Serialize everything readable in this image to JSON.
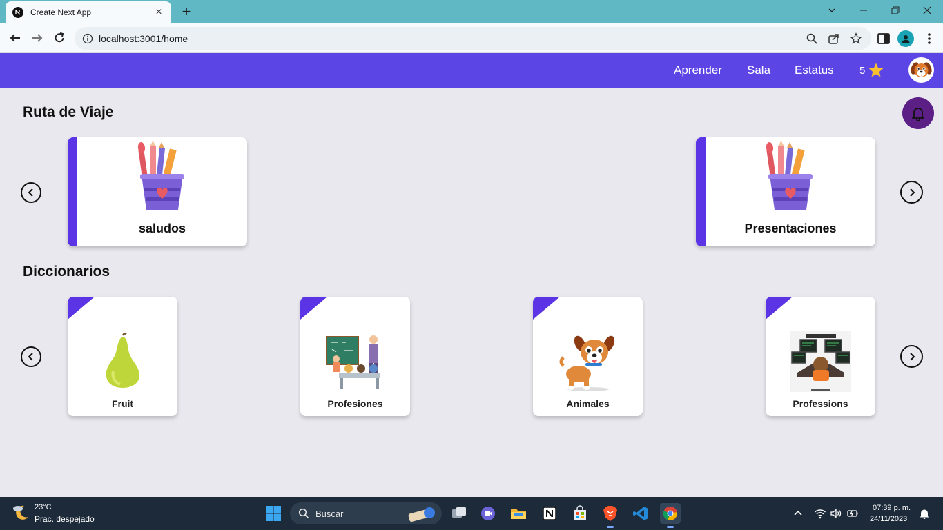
{
  "browser": {
    "tab_title": "Create Next App",
    "url": "localhost:3001/home",
    "icons": [
      "back-icon",
      "forward-icon",
      "reload-icon",
      "info-icon",
      "zoom-icon",
      "share-icon",
      "bookmark-star-icon",
      "side-panel-icon",
      "profile-icon",
      "menu-icon"
    ]
  },
  "header": {
    "nav": [
      "Aprender",
      "Sala",
      "Estatus"
    ],
    "stars": "5",
    "accent": "#5b46e5"
  },
  "route": {
    "title": "Ruta de Viaje",
    "cards": [
      {
        "label": "saludos"
      },
      {
        "label": "Presentaciones"
      }
    ]
  },
  "dictionaries": {
    "title": "Diccionarios",
    "cards": [
      {
        "label": "Fruit"
      },
      {
        "label": "Profesiones"
      },
      {
        "label": "Animales"
      },
      {
        "label": "Professions"
      }
    ]
  },
  "taskbar": {
    "temperature": "23°C",
    "weather": "Prac. despejado",
    "search_placeholder": "Buscar",
    "time": "07:39 p. m.",
    "date": "24/11/2023"
  }
}
